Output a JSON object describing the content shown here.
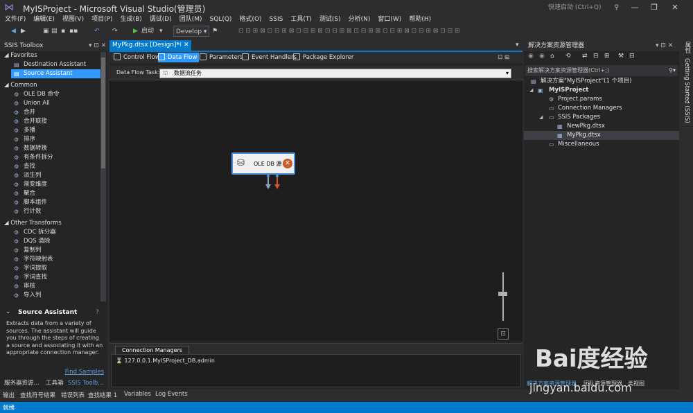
{
  "window": {
    "title": "MyISProject - Microsoft Visual Studio(管理员)",
    "quick_launch": "快速启动 (Ctrl+Q)"
  },
  "menu": [
    "文件(F)",
    "编辑(E)",
    "视图(V)",
    "项目(P)",
    "生成(B)",
    "调试(D)",
    "团队(M)",
    "SQL(Q)",
    "格式(O)",
    "SSIS",
    "工具(T)",
    "测试(S)",
    "分析(N)",
    "窗口(W)",
    "帮助(H)"
  ],
  "toolbar": {
    "start": "启动",
    "config": "Develop"
  },
  "toolbox": {
    "title": "SSIS Toolbox",
    "groups": [
      {
        "name": "Favorites",
        "items": [
          "Destination Assistant",
          "Source Assistant"
        ]
      },
      {
        "name": "Common",
        "items": [
          "OLE DB 命令",
          "Union All",
          "合并",
          "合并联接",
          "多播",
          "排序",
          "数据转换",
          "有条件拆分",
          "查找",
          "派生列",
          "渐变维度",
          "聚合",
          "脚本组件",
          "行计数"
        ]
      },
      {
        "name": "Other Transforms",
        "items": [
          "CDC 拆分器",
          "DQS 清除",
          "复制列",
          "字符映射表",
          "字词提取",
          "字词查找",
          "审核",
          "导入列"
        ]
      }
    ],
    "selected": "Source Assistant",
    "description": {
      "title": "Source Assistant",
      "text": "Extracts data from a variety of sources. The assistant will guide you through the steps of creating a source and associating it with an appropriate connection manager.",
      "link": "Find Samples"
    },
    "tabs": [
      "服务器资源...",
      "工具箱",
      "SSIS Toolb..."
    ]
  },
  "document": {
    "tab": "MyPkg.dtsx [Design]*",
    "designer_tabs": [
      "Control Flow",
      "Data Flow",
      "Parameters",
      "Event Handlers",
      "Package Explorer"
    ],
    "active_designer_tab": "Data Flow",
    "task_label": "Data Flow Task:",
    "task_value": "数据流任务",
    "component": "OLE DB 源",
    "connection_managers_tab": "Connection Managers",
    "connection": "127.0.0.1.MyISProject_DB.admin"
  },
  "solution_explorer": {
    "title": "解决方案资源管理器",
    "search_placeholder": "搜索解决方案资源管理器(Ctrl+;)",
    "tree": [
      {
        "label": "解决方案\"MyISProject\"(1 个项目)",
        "level": 0
      },
      {
        "label": "MyISProject",
        "level": 1,
        "bold": true
      },
      {
        "label": "Project.params",
        "level": 2
      },
      {
        "label": "Connection Managers",
        "level": 2
      },
      {
        "label": "SSIS Packages",
        "level": 2
      },
      {
        "label": "NewPkg.dtsx",
        "level": 3
      },
      {
        "label": "MyPkg.dtsx",
        "level": 3,
        "selected": true
      },
      {
        "label": "Miscellaneous",
        "level": 2
      }
    ],
    "tabs": [
      "解决方案资源管理器",
      "团队资源管理器",
      "类视图"
    ]
  },
  "side_strip": [
    "属性",
    "Getting Started (SSIS)"
  ],
  "output_tabs": [
    "输出",
    "查找符号结果",
    "错误列表",
    "查找结果 1",
    "Variables",
    "Log Events"
  ],
  "status": "就绪",
  "watermark": {
    "brand": "Bai度经验",
    "url": "jingyan.baidu.com"
  }
}
